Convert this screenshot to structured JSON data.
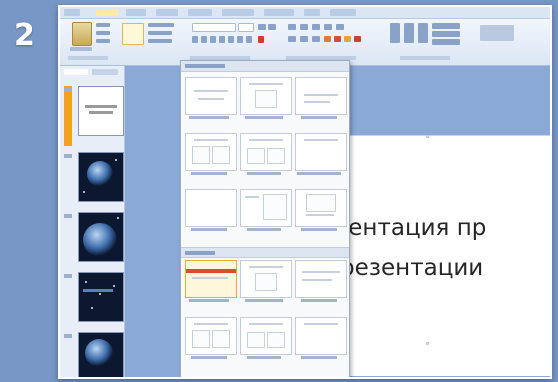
{
  "step_number": "2",
  "slide": {
    "title_line1": "Презентация пр",
    "title_line2": "презентации"
  },
  "slides_panel": {
    "thumbnails": [
      {
        "kind": "title-slide",
        "selected": true
      },
      {
        "kind": "space-image"
      },
      {
        "kind": "space-image"
      },
      {
        "kind": "space-image"
      },
      {
        "kind": "space-image"
      }
    ]
  },
  "layout_gallery": {
    "layouts": [
      "title-slide",
      "title-and-content",
      "section-header",
      "two-content",
      "comparison",
      "title-only",
      "blank",
      "content-with-caption",
      "picture-with-caption",
      "theme-title",
      "theme-content",
      "theme-section",
      "theme-two-content",
      "theme-comparison",
      "theme-blank"
    ]
  },
  "colors": {
    "background": "#7897c6",
    "accent": "#f4a11e",
    "ribbon": "#dbe6f4"
  }
}
